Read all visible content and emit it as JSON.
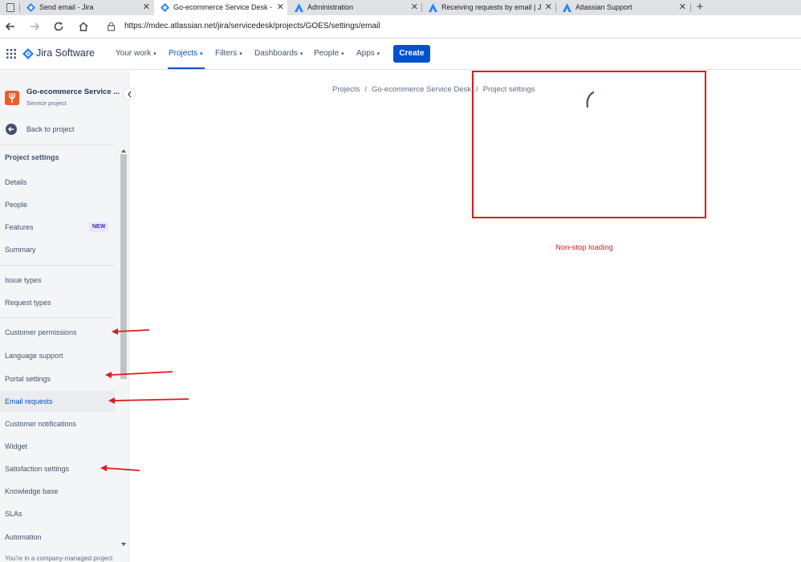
{
  "browser": {
    "tabs": [
      {
        "title": "Send email - Jira",
        "icon": "jira-icon"
      },
      {
        "title": "Go-ecommerce Service Desk - Email",
        "icon": "jira-icon"
      },
      {
        "title": "Administration",
        "icon": "atlassian-icon"
      },
      {
        "title": "Receiving requests by email | Jira Service Management",
        "icon": "atlassian-icon"
      },
      {
        "title": "Atlassian Support",
        "icon": "atlassian-icon"
      }
    ],
    "close_glyph": "✕",
    "new_tab_glyph": "+",
    "url": "https://mdec.atlassian.net/jira/servicedesk/projects/GOES/settings/email"
  },
  "topnav": {
    "product": "Jira Software",
    "items": [
      {
        "label": "Your work"
      },
      {
        "label": "Projects"
      },
      {
        "label": "Filters"
      },
      {
        "label": "Dashboards"
      },
      {
        "label": "People"
      },
      {
        "label": "Apps"
      }
    ],
    "create_label": "Create",
    "accent": "#0052cc"
  },
  "sidebar": {
    "project_name": "Go-ecommerce Service ...",
    "project_type": "Service project",
    "back_label": "Back to project",
    "section_title": "Project settings",
    "items": [
      {
        "label": "Details"
      },
      {
        "label": "People"
      },
      {
        "label": "Features",
        "badge": "NEW"
      },
      {
        "label": "Summary"
      },
      {
        "label": "Issue types"
      },
      {
        "label": "Request types"
      },
      {
        "label": "Customer permissions"
      },
      {
        "label": "Language support"
      },
      {
        "label": "Portal settings"
      },
      {
        "label": "Email requests",
        "selected": true
      },
      {
        "label": "Customer notifications"
      },
      {
        "label": "Widget"
      },
      {
        "label": "Satisfaction settings"
      },
      {
        "label": "Knowledge base"
      },
      {
        "label": "SLAs"
      },
      {
        "label": "Automation"
      }
    ],
    "footer_text": "You're in a company-managed project"
  },
  "breadcrumb": {
    "items": [
      "Projects",
      "Go-ecommerce Service Desk",
      "Project settings"
    ],
    "separator": "/"
  },
  "annotation": {
    "text": "Non-stop loading",
    "color": "#e01b1b"
  }
}
